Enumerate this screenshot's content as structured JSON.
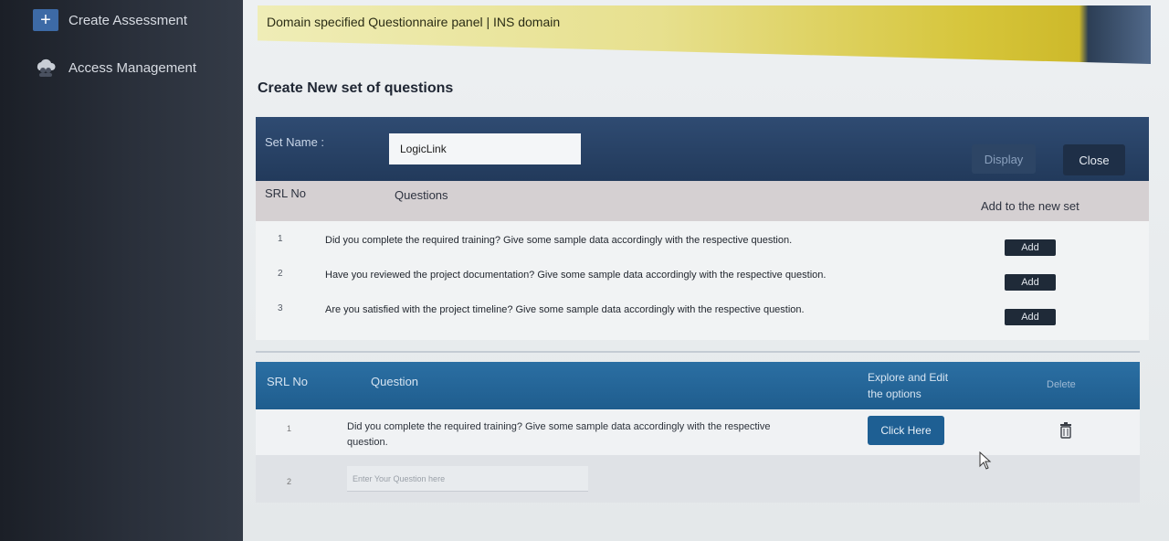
{
  "sidebar": {
    "items": [
      {
        "label": "Create Assessment",
        "icon": "plus-icon"
      },
      {
        "label": "Access Management",
        "icon": "cloud-users-icon"
      }
    ]
  },
  "banner": {
    "title": "Domain specified Questionnaire panel | INS domain"
  },
  "page": {
    "title": "Create New set of questions"
  },
  "set": {
    "label": "Set Name :",
    "value": "LogicLink",
    "display_label": "Display",
    "close_label": "Close"
  },
  "questions_table": {
    "headers": {
      "srl": "SRL No",
      "questions": "Questions",
      "add": "Add to the new set"
    },
    "add_label": "Add",
    "rows": [
      {
        "srl": "1",
        "text": "Did you complete the required training? Give some sample data accordingly with the respective question."
      },
      {
        "srl": "2",
        "text": "Have you reviewed the project documentation? Give some sample data accordingly with the respective question."
      },
      {
        "srl": "3",
        "text": "Are you satisfied with the project timeline? Give some sample data accordingly with the respective question."
      }
    ]
  },
  "selected_table": {
    "headers": {
      "srl": "SRL No",
      "question": "Question",
      "explore_line1": "Explore and Edit",
      "explore_line2": "the options",
      "delete": "Delete"
    },
    "rows": [
      {
        "srl": "1",
        "text": "Did you complete the required training? Give some sample data accordingly with the respective question.",
        "button": "Click Here"
      },
      {
        "srl": "2",
        "placeholder": "Enter Your Question here"
      }
    ]
  },
  "colors": {
    "accent": "#1e5f93",
    "header_dark": "#223a5b",
    "banner_yellow": "#d6c53a"
  }
}
